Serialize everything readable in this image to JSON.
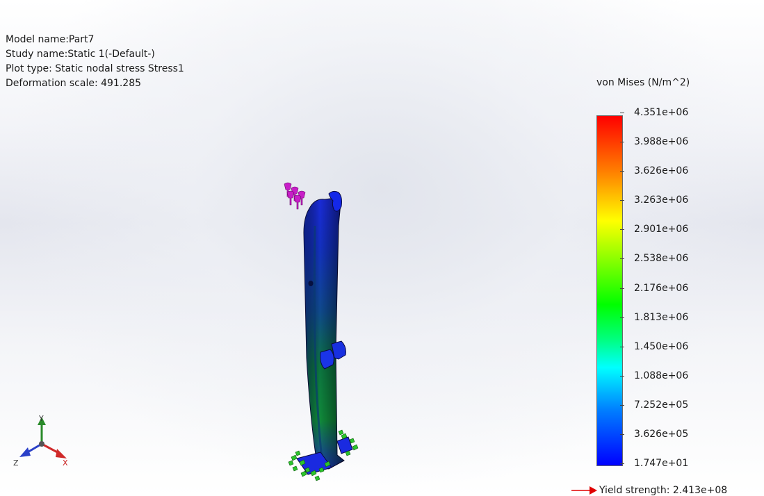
{
  "study_info": {
    "model_name": "Model name:Part7",
    "study_name": "Study name:Static 1(-Default-)",
    "plot_type": "Plot type: Static nodal stress Stress1",
    "deformation_scale": "Deformation scale: 491.285"
  },
  "legend": {
    "title": "von Mises (N/m^2)",
    "tick_labels": [
      "4.351e+06",
      "3.988e+06",
      "3.626e+06",
      "3.263e+06",
      "2.901e+06",
      "2.538e+06",
      "2.176e+06",
      "1.813e+06",
      "1.450e+06",
      "1.088e+06",
      "7.252e+05",
      "3.626e+05",
      "1.747e+01"
    ],
    "colors": {
      "max": "#ff0000",
      "min": "#0000ff"
    }
  },
  "yield_strength": "Yield strength: 2.413e+08",
  "triad": {
    "y_label": "Y",
    "z_label": "Z",
    "x_label": "X"
  },
  "model": {
    "load_color": "#c81ec8",
    "fixture_color": "#2cc42c",
    "max_stress_color": "#00c000",
    "min_stress_color": "#1020e0"
  }
}
